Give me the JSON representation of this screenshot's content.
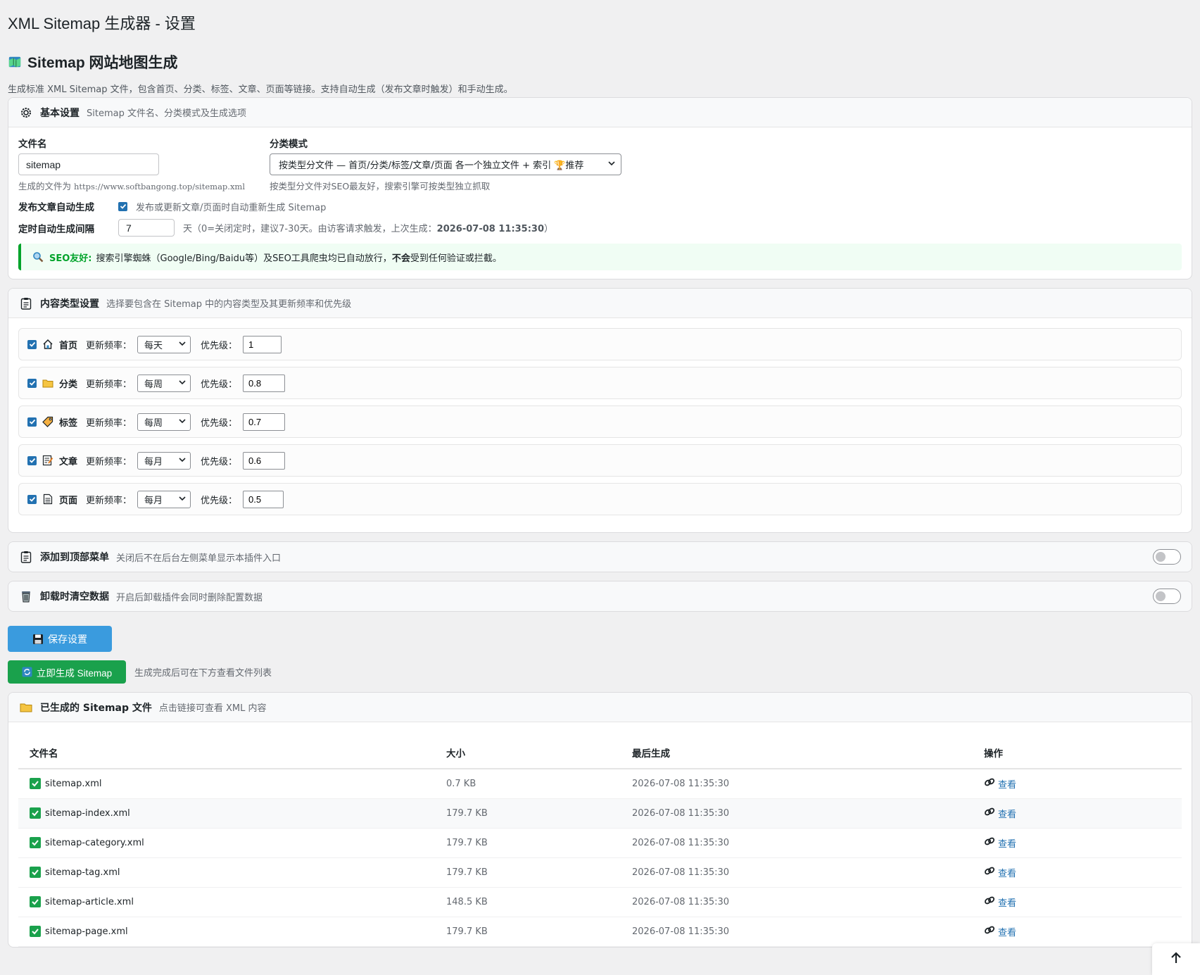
{
  "page_title": "XML Sitemap 生成器 - 设置",
  "heading": "Sitemap 网站地图生成",
  "subtitle": "生成标准 XML Sitemap 文件，包含首页、分类、标签、文章、页面等链接。支持自动生成（发布文章时触发）和手动生成。",
  "basic": {
    "title": "基本设置",
    "desc": "Sitemap 文件名、分类模式及生成选项",
    "filename_label": "文件名",
    "filename_value": "sitemap",
    "filename_hint_prefix": "生成的文件为 ",
    "filename_hint_url": "https://www.softbangong.top/sitemap.xml",
    "mode_label": "分类模式",
    "mode_value": "按类型分文件 — 首页/分类/标签/文章/页面 各一个独立文件 + 索引 🏆推荐",
    "mode_hint": "按类型分文件对SEO最友好，搜索引擎可按类型独立抓取",
    "auto_label": "发布文章自动生成",
    "auto_text": "发布或更新文章/页面时自动重新生成 Sitemap",
    "interval_label": "定时自动生成间隔",
    "interval_value": "7",
    "interval_hint_prefix": "天（0=关闭定时，建议7-30天。由访客请求触发，上次生成：",
    "interval_hint_time": "2026-07-08 11:35:30",
    "interval_hint_suffix": "）",
    "seo_label": "SEO友好:",
    "seo_text_1": "搜索引擎蜘蛛（Google/Bing/Baidu等）及SEO工具爬虫均已自动放行，",
    "seo_bold": "不会",
    "seo_text_2": "受到任何验证或拦截。"
  },
  "content": {
    "title": "内容类型设置",
    "desc": "选择要包含在 Sitemap 中的内容类型及其更新频率和优先级",
    "freq_label": "更新频率：",
    "prio_label": "优先级：",
    "items": [
      {
        "name": "首页",
        "icon": "home-icon",
        "freq": "每天",
        "priority": "1"
      },
      {
        "name": "分类",
        "icon": "folder-icon",
        "freq": "每周",
        "priority": "0.8"
      },
      {
        "name": "标签",
        "icon": "tag-icon",
        "freq": "每周",
        "priority": "0.7"
      },
      {
        "name": "文章",
        "icon": "memo-icon",
        "freq": "每月",
        "priority": "0.6"
      },
      {
        "name": "页面",
        "icon": "page-icon",
        "freq": "每月",
        "priority": "0.5"
      }
    ]
  },
  "menu_toggle": {
    "title": "添加到顶部菜单",
    "desc": "关闭后不在后台左侧菜单显示本插件入口"
  },
  "uninstall_toggle": {
    "title": "卸载时清空数据",
    "desc": "开启后卸载插件会同时删除配置数据"
  },
  "buttons": {
    "save": "保存设置",
    "generate": "立即生成 Sitemap",
    "generate_hint": "生成完成后可在下方查看文件列表"
  },
  "files": {
    "title": "已生成的 Sitemap 文件",
    "desc": "点击链接可查看 XML 内容",
    "columns": [
      "文件名",
      "大小",
      "最后生成",
      "操作"
    ],
    "view_label": "查看",
    "rows": [
      {
        "name": "sitemap.xml",
        "size": "0.7 KB",
        "time": "2026-07-08 11:35:30"
      },
      {
        "name": "sitemap-index.xml",
        "size": "179.7 KB",
        "time": "2026-07-08 11:35:30"
      },
      {
        "name": "sitemap-category.xml",
        "size": "179.7 KB",
        "time": "2026-07-08 11:35:30"
      },
      {
        "name": "sitemap-tag.xml",
        "size": "179.7 KB",
        "time": "2026-07-08 11:35:30"
      },
      {
        "name": "sitemap-article.xml",
        "size": "148.5 KB",
        "time": "2026-07-08 11:35:30"
      },
      {
        "name": "sitemap-page.xml",
        "size": "179.7 KB",
        "time": "2026-07-08 11:35:30"
      }
    ]
  },
  "colors": {
    "primary": "#2271b1",
    "save_button": "#3a9bde",
    "generate_button": "#1aa14c",
    "seo_accent": "#00a32a"
  }
}
